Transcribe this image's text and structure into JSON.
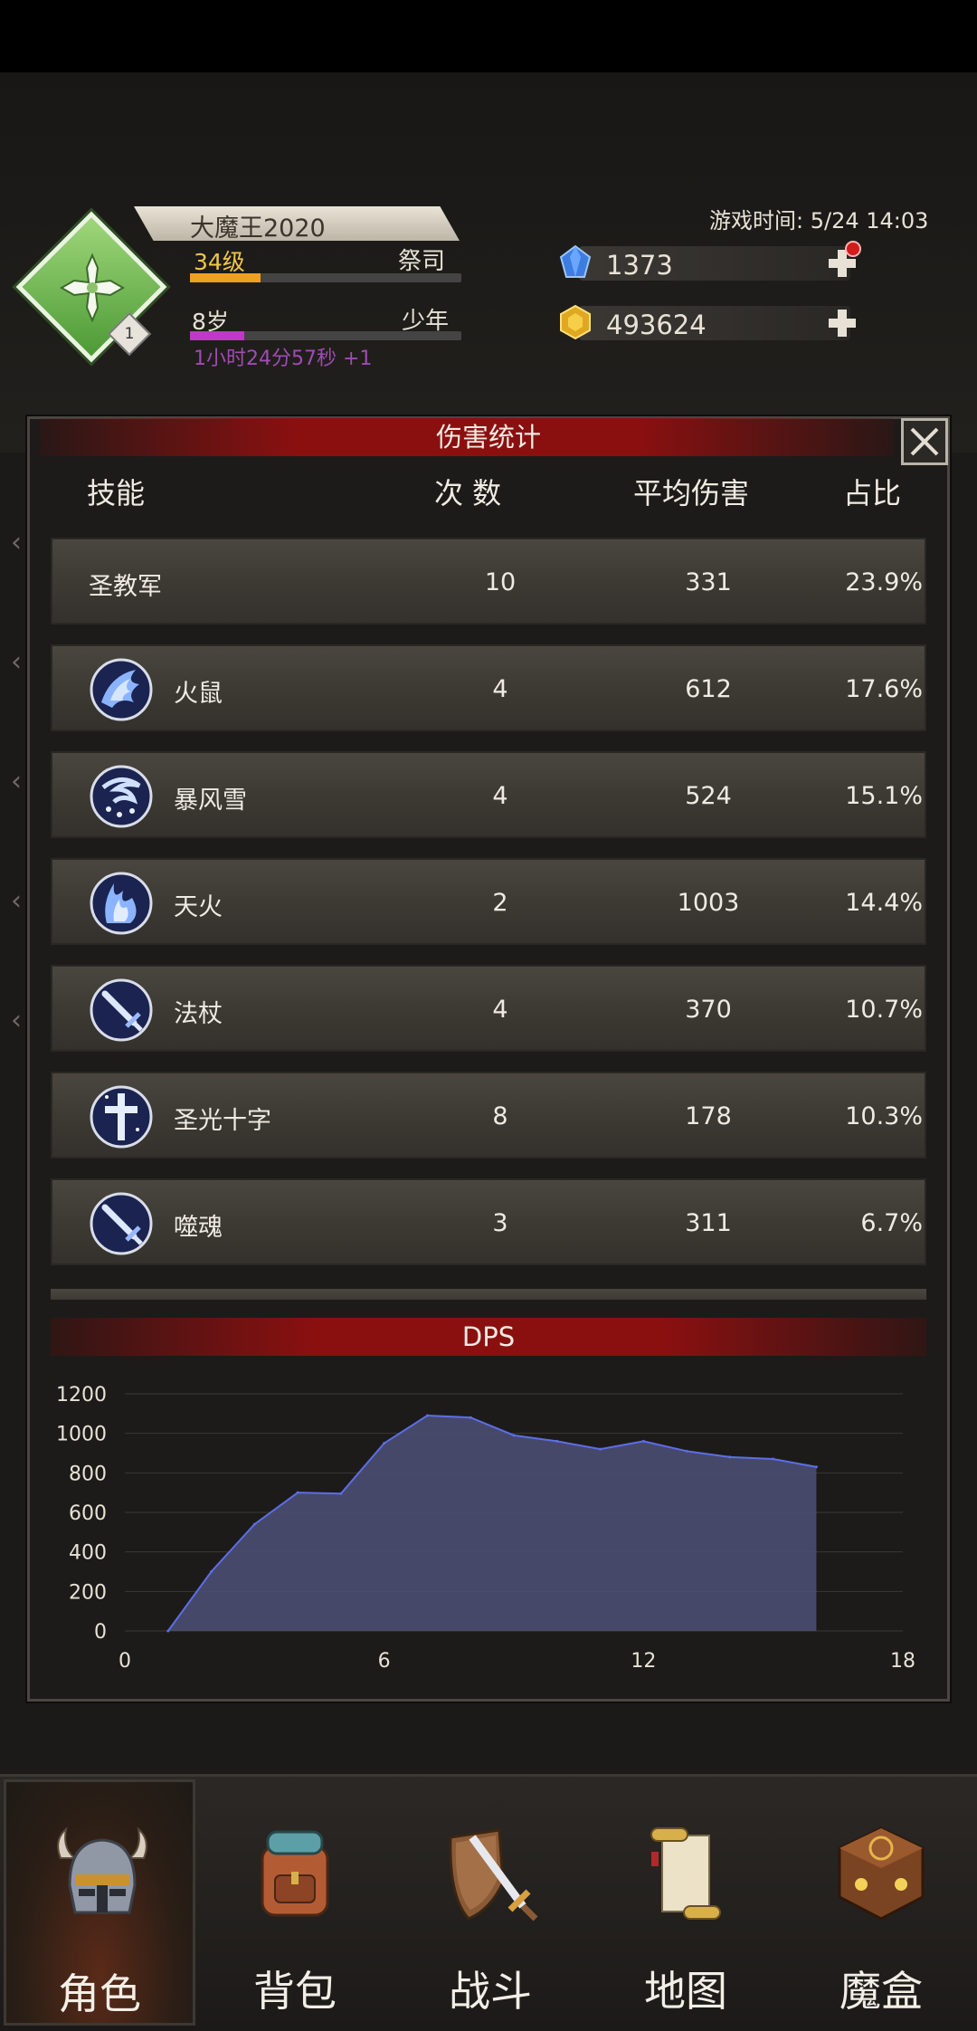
{
  "header": {
    "player_name": "大魔王2020",
    "level": "34级",
    "class_name": "祭司",
    "age": "8岁",
    "age_stage": "少年",
    "play_time": "1小时24分57秒 +1",
    "emblem_badge": "1",
    "game_time": "游戏时间: 5/24 14:03",
    "xp_progress": 0.26,
    "age_progress": 0.2
  },
  "currency": {
    "gems": "1373",
    "gold": "493624"
  },
  "modal": {
    "title": "伤害统计",
    "columns": {
      "skill": "技能",
      "count": "次 数",
      "avg": "平均伤害",
      "share": "占比"
    },
    "rows": [
      {
        "name": "圣教军",
        "count": "10",
        "avg": "331",
        "share": "23.9%",
        "icon": "none"
      },
      {
        "name": "火鼠",
        "count": "4",
        "avg": "612",
        "share": "17.6%",
        "icon": "fire-rat-icon"
      },
      {
        "name": "暴风雪",
        "count": "4",
        "avg": "524",
        "share": "15.1%",
        "icon": "blizzard-icon"
      },
      {
        "name": "天火",
        "count": "2",
        "avg": "1003",
        "share": "14.4%",
        "icon": "sky-fire-icon"
      },
      {
        "name": "法杖",
        "count": "4",
        "avg": "370",
        "share": "10.7%",
        "icon": "staff-sword-icon"
      },
      {
        "name": "圣光十字",
        "count": "8",
        "avg": "178",
        "share": "10.3%",
        "icon": "holy-cross-icon"
      },
      {
        "name": "噬魂",
        "count": "3",
        "avg": "311",
        "share": "6.7%",
        "icon": "soul-sword-icon"
      }
    ]
  },
  "dps": {
    "title": "DPS"
  },
  "chart_data": {
    "type": "area",
    "title": "DPS",
    "xlim": [
      0,
      18
    ],
    "ylim": [
      0,
      1200
    ],
    "xticks": [
      0,
      6,
      12,
      18
    ],
    "yticks": [
      0,
      200,
      400,
      600,
      800,
      1000,
      1200
    ],
    "grid": true,
    "x": [
      1,
      2,
      3,
      4,
      5,
      6,
      7,
      8,
      9,
      10,
      11,
      12,
      13,
      14,
      15,
      16
    ],
    "values": [
      0,
      300,
      540,
      700,
      695,
      950,
      1090,
      1080,
      990,
      960,
      920,
      960,
      910,
      880,
      870,
      830
    ],
    "fill_color": "#4b4e72",
    "line_color": "#5c6ee8"
  },
  "nav": {
    "items": [
      {
        "label": "角色",
        "icon": "helmet-icon",
        "active": true
      },
      {
        "label": "背包",
        "icon": "backpack-icon",
        "active": false
      },
      {
        "label": "战斗",
        "icon": "sword-shield-icon",
        "active": false
      },
      {
        "label": "地图",
        "icon": "scroll-map-icon",
        "active": false
      },
      {
        "label": "魔盒",
        "icon": "magic-box-icon",
        "active": false
      }
    ]
  },
  "colors": {
    "accent_red": "#8a1010",
    "gold_text": "#f0c64a",
    "purple_text": "#a04bb4"
  }
}
